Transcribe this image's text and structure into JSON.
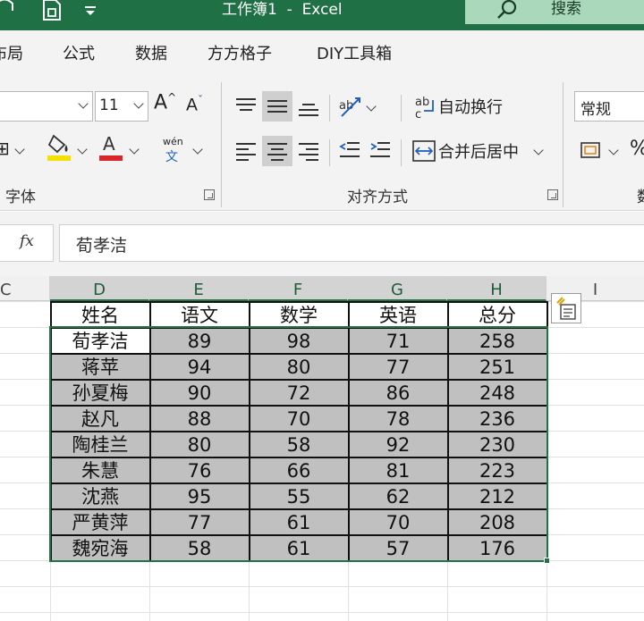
{
  "titlebar": {
    "doc_title": "工作簿1  -  Excel",
    "search_label": "搜索"
  },
  "tabs": [
    "布局",
    "公式",
    "数据",
    "方方格子",
    "DIY工具箱"
  ],
  "ribbon": {
    "font_size": "11",
    "wrap_text": "自动换行",
    "merge_center": "合并后居中",
    "number_format": "常规",
    "phonetic_top": "wén",
    "phonetic_bottom": "文",
    "font_group": "字体",
    "align_group": "对齐方式",
    "accent_colors": {
      "fill": "#f5e100",
      "font": "#d9262b"
    }
  },
  "formula_bar": {
    "fx": "fx",
    "content": "荀孝洁"
  },
  "grid": {
    "columns": [
      "C",
      "D",
      "E",
      "F",
      "G",
      "H",
      "I"
    ],
    "selected_columns": [
      "D",
      "E",
      "F",
      "G",
      "H"
    ],
    "headers": [
      "姓名",
      "语文",
      "数学",
      "英语",
      "总分"
    ],
    "rows": [
      [
        "荀孝洁",
        "89",
        "98",
        "71",
        "258"
      ],
      [
        "蒋苹",
        "94",
        "80",
        "77",
        "251"
      ],
      [
        "孙夏梅",
        "90",
        "72",
        "86",
        "248"
      ],
      [
        "赵凡",
        "88",
        "70",
        "78",
        "236"
      ],
      [
        "陶桂兰",
        "80",
        "58",
        "92",
        "230"
      ],
      [
        "朱慧",
        "76",
        "66",
        "81",
        "223"
      ],
      [
        "沈燕",
        "95",
        "55",
        "62",
        "212"
      ],
      [
        "严黄萍",
        "77",
        "61",
        "70",
        "208"
      ],
      [
        "魏宛海",
        "58",
        "61",
        "57",
        "176"
      ]
    ]
  }
}
